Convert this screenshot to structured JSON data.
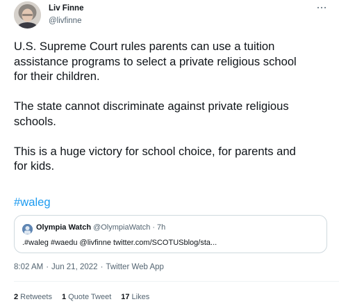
{
  "author": {
    "name": "Liv Finne",
    "handle": "@livfinne"
  },
  "tweet": {
    "paragraphs": [
      [
        "U.S. Supreme Court rules parents can use a tuition",
        "assistance programs to select a private religious school",
        "for their children."
      ],
      [
        "The state cannot discriminate against private religious",
        "schools."
      ],
      [
        "This is a huge victory for school choice, for parents and",
        "for kids."
      ]
    ],
    "hashtag": "#waleg"
  },
  "quote": {
    "name": "Olympia Watch",
    "handle": "@OlympiaWatch",
    "separator": "·",
    "time": "7h",
    "text": ".#waleg #waedu @livfinne twitter.com/SCOTUSblog/sta..."
  },
  "meta": {
    "time": "8:02 AM",
    "date": "Jun 21, 2022",
    "source": "Twitter Web App",
    "separator": "·"
  },
  "stats": {
    "retweets": {
      "count": "2",
      "label": "Retweets"
    },
    "quotes": {
      "count": "1",
      "label": "Quote Tweet"
    },
    "likes": {
      "count": "17",
      "label": "Likes"
    }
  },
  "colors": {
    "link": "#1d9bf0",
    "text": "#0f1419",
    "secondary": "#536471",
    "border": "#cfd9de"
  },
  "icons": {
    "more": "more-horizontal-icon"
  }
}
